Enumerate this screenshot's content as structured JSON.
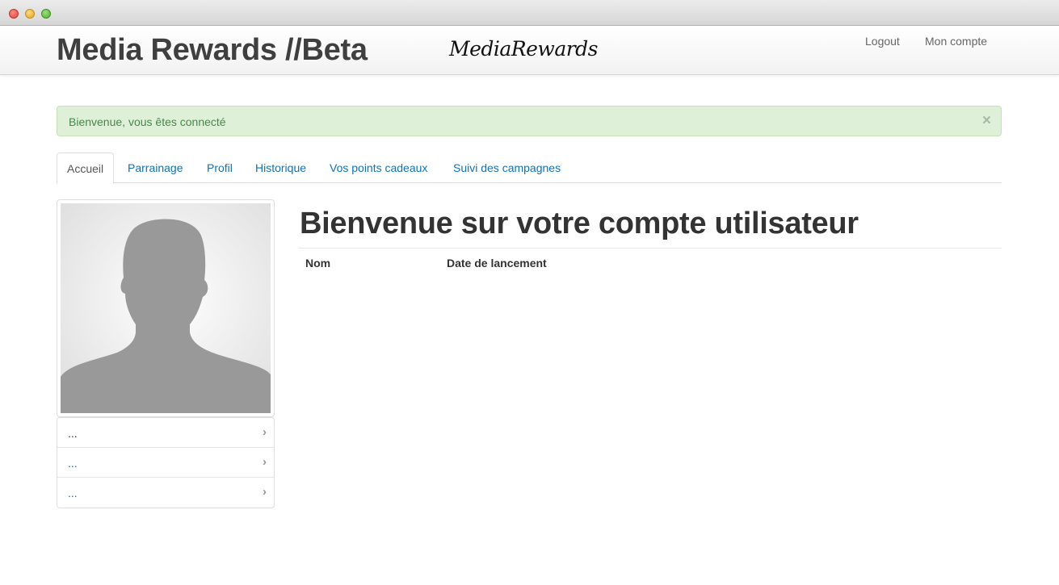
{
  "window": {
    "buttons": [
      "close",
      "minimize",
      "maximize"
    ]
  },
  "navbar": {
    "brand": "Media Rewards //Beta",
    "logo_text": "MediaRewards",
    "links": {
      "logout": "Logout",
      "account": "Mon compte"
    }
  },
  "alert": {
    "message": "Bienvenue, vous êtes connecté",
    "close": "×",
    "color": "#468847"
  },
  "tabs": [
    {
      "label": "Accueil",
      "active": true
    },
    {
      "label": "Parrainage",
      "active": false
    },
    {
      "label": "Profil",
      "active": false
    },
    {
      "label": "Historique",
      "active": false
    },
    {
      "label": "Vos points cadeaux",
      "active": false
    },
    {
      "label": "Suivi des campagnes",
      "active": false
    }
  ],
  "sidebar": {
    "avatar_icon": "user-silhouette-icon",
    "items": [
      {
        "label": "...",
        "icon": "chevron-right-icon"
      },
      {
        "label": "...",
        "icon": "chevron-right-icon"
      },
      {
        "label": "...",
        "icon": "chevron-right-icon"
      }
    ]
  },
  "main": {
    "title": "Bienvenue sur votre compte utilisateur",
    "table": {
      "columns": [
        "Nom",
        "Date de lancement"
      ],
      "rows": []
    }
  },
  "colors": {
    "link": "#0f72b7",
    "alert_bg": "#dff0d8",
    "brand_text": "#3f3f3f"
  }
}
